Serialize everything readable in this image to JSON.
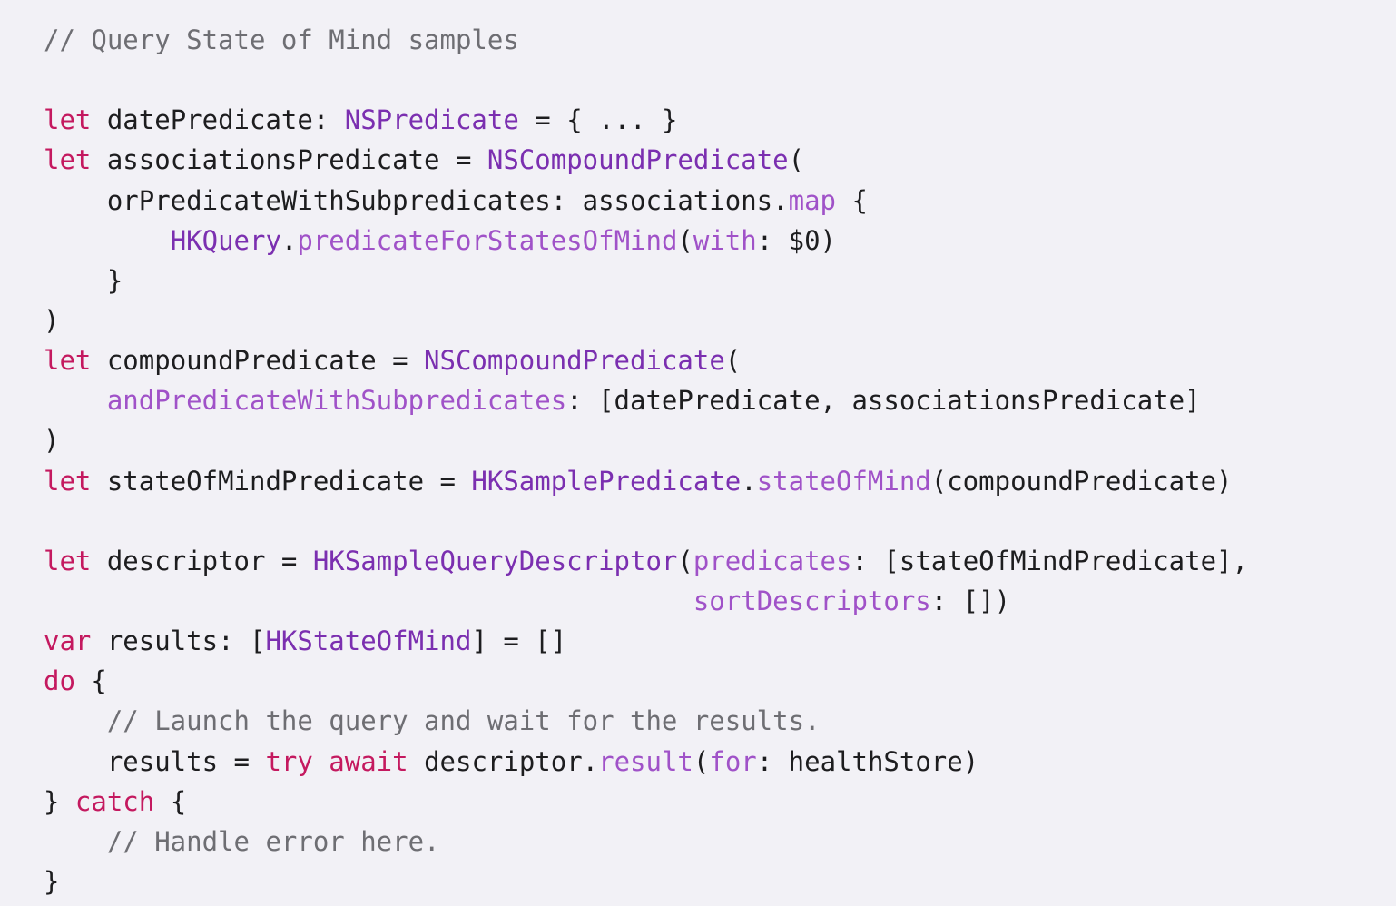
{
  "colors": {
    "background": "#f2f1f6",
    "keyword": "#c4195f",
    "type": "#7b2fb0",
    "function": "#a052c8",
    "comment": "#6e6e73",
    "plain": "#1d1d1f"
  },
  "code": {
    "lines": [
      [
        {
          "t": "cm",
          "v": "// Query State of Mind samples"
        }
      ],
      [],
      [
        {
          "t": "kw",
          "v": "let"
        },
        {
          "t": "pl",
          "v": " datePredicate: "
        },
        {
          "t": "ty",
          "v": "NSPredicate"
        },
        {
          "t": "pl",
          "v": " = { ... }"
        }
      ],
      [
        {
          "t": "kw",
          "v": "let"
        },
        {
          "t": "pl",
          "v": " associationsPredicate = "
        },
        {
          "t": "ty",
          "v": "NSCompoundPredicate"
        },
        {
          "t": "pl",
          "v": "("
        }
      ],
      [
        {
          "t": "pl",
          "v": "    orPredicateWithSubpredicates: associations."
        },
        {
          "t": "fn",
          "v": "map"
        },
        {
          "t": "pl",
          "v": " {"
        }
      ],
      [
        {
          "t": "pl",
          "v": "        "
        },
        {
          "t": "ty",
          "v": "HKQuery"
        },
        {
          "t": "pl",
          "v": "."
        },
        {
          "t": "fn",
          "v": "predicateForStatesOfMind"
        },
        {
          "t": "pl",
          "v": "("
        },
        {
          "t": "fn",
          "v": "with"
        },
        {
          "t": "pl",
          "v": ": $0)"
        }
      ],
      [
        {
          "t": "pl",
          "v": "    }"
        }
      ],
      [
        {
          "t": "pl",
          "v": ")"
        }
      ],
      [
        {
          "t": "kw",
          "v": "let"
        },
        {
          "t": "pl",
          "v": " compoundPredicate = "
        },
        {
          "t": "ty",
          "v": "NSCompoundPredicate"
        },
        {
          "t": "pl",
          "v": "("
        }
      ],
      [
        {
          "t": "pl",
          "v": "    "
        },
        {
          "t": "fn",
          "v": "andPredicateWithSubpredicates"
        },
        {
          "t": "pl",
          "v": ": [datePredicate, associationsPredicate]"
        }
      ],
      [
        {
          "t": "pl",
          "v": ")"
        }
      ],
      [
        {
          "t": "kw",
          "v": "let"
        },
        {
          "t": "pl",
          "v": " stateOfMindPredicate = "
        },
        {
          "t": "ty",
          "v": "HKSamplePredicate"
        },
        {
          "t": "pl",
          "v": "."
        },
        {
          "t": "fn",
          "v": "stateOfMind"
        },
        {
          "t": "pl",
          "v": "(compoundPredicate)"
        }
      ],
      [],
      [
        {
          "t": "kw",
          "v": "let"
        },
        {
          "t": "pl",
          "v": " descriptor = "
        },
        {
          "t": "ty",
          "v": "HKSampleQueryDescriptor"
        },
        {
          "t": "pl",
          "v": "("
        },
        {
          "t": "fn",
          "v": "predicates"
        },
        {
          "t": "pl",
          "v": ": [stateOfMindPredicate],"
        }
      ],
      [
        {
          "t": "pl",
          "v": "                                         "
        },
        {
          "t": "fn",
          "v": "sortDescriptors"
        },
        {
          "t": "pl",
          "v": ": [])"
        }
      ],
      [
        {
          "t": "kw",
          "v": "var"
        },
        {
          "t": "pl",
          "v": " results: ["
        },
        {
          "t": "ty",
          "v": "HKStateOfMind"
        },
        {
          "t": "pl",
          "v": "] = []"
        }
      ],
      [
        {
          "t": "kw",
          "v": "do"
        },
        {
          "t": "pl",
          "v": " {"
        }
      ],
      [
        {
          "t": "pl",
          "v": "    "
        },
        {
          "t": "cm",
          "v": "// Launch the query and wait for the results."
        }
      ],
      [
        {
          "t": "pl",
          "v": "    results = "
        },
        {
          "t": "kw",
          "v": "try"
        },
        {
          "t": "pl",
          "v": " "
        },
        {
          "t": "kw",
          "v": "await"
        },
        {
          "t": "pl",
          "v": " descriptor."
        },
        {
          "t": "fn",
          "v": "result"
        },
        {
          "t": "pl",
          "v": "("
        },
        {
          "t": "fn",
          "v": "for"
        },
        {
          "t": "pl",
          "v": ": healthStore)"
        }
      ],
      [
        {
          "t": "pl",
          "v": "} "
        },
        {
          "t": "kw",
          "v": "catch"
        },
        {
          "t": "pl",
          "v": " {"
        }
      ],
      [
        {
          "t": "pl",
          "v": "    "
        },
        {
          "t": "cm",
          "v": "// Handle error here."
        }
      ],
      [
        {
          "t": "pl",
          "v": "}"
        }
      ]
    ]
  }
}
